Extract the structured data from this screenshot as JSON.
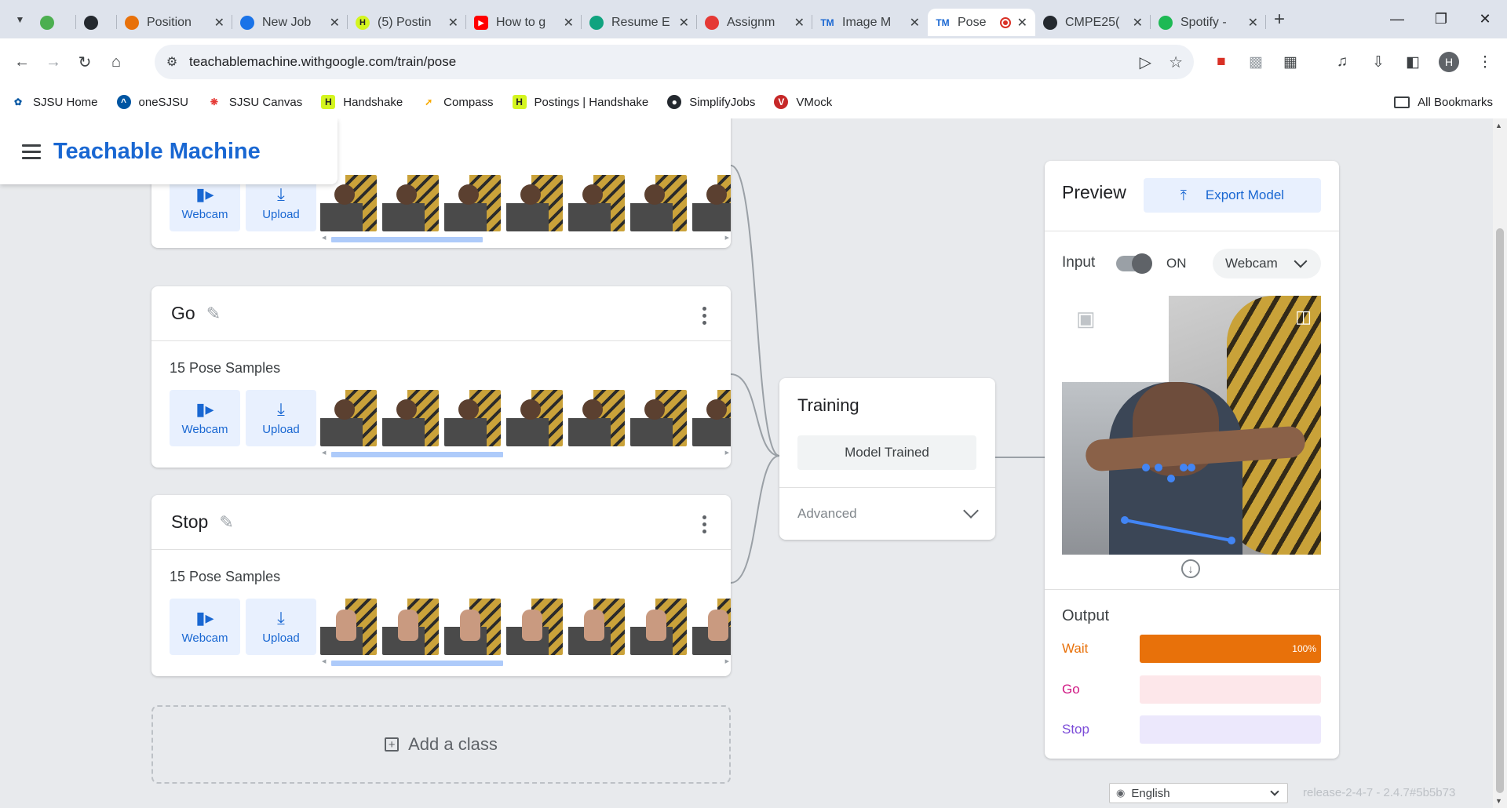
{
  "browser": {
    "tabs": [
      {
        "label": "",
        "favicon_color": "#4caf50",
        "favicon_text": ""
      },
      {
        "label": "",
        "favicon_color": "#24292f",
        "favicon_text": ""
      },
      {
        "label": "Position",
        "favicon_color": "#e8710a",
        "favicon_text": ""
      },
      {
        "label": "New Job",
        "favicon_color": "#1a73e8",
        "favicon_text": ""
      },
      {
        "label": "(5) Postin",
        "favicon_color": "#d4f51f",
        "favicon_text": "H"
      },
      {
        "label": "How to g",
        "favicon_color": "#ff0000",
        "favicon_text": "▶"
      },
      {
        "label": "Resume E",
        "favicon_color": "#10a37f",
        "favicon_text": ""
      },
      {
        "label": "Assignm",
        "favicon_color": "#e53935",
        "favicon_text": ""
      },
      {
        "label": "Image M",
        "favicon_color": "#1967d2",
        "favicon_text": "TM"
      },
      {
        "label": "Pose",
        "favicon_color": "#1967d2",
        "favicon_text": "TM",
        "active": true
      },
      {
        "label": "CMPE25(",
        "favicon_color": "#24292f",
        "favicon_text": ""
      },
      {
        "label": "Spotify -",
        "favicon_color": "#1db954",
        "favicon_text": ""
      }
    ],
    "url": "teachablemachine.withgoogle.com/train/pose",
    "profile_initial": "H",
    "bookmarks": [
      {
        "label": "SJSU Home",
        "icon": "sjsu-icon",
        "color": "#0055a2"
      },
      {
        "label": "oneSJSU",
        "icon": "onesjsu-icon",
        "color": "#0055a2"
      },
      {
        "label": "SJSU Canvas",
        "icon": "canvas-icon",
        "color": "#e53935"
      },
      {
        "label": "Handshake",
        "icon": "handshake-icon",
        "color": "#d4f51f"
      },
      {
        "label": "Compass",
        "icon": "compass-icon",
        "color": "#f9ab00"
      },
      {
        "label": "Postings | Handshake",
        "icon": "handshake-icon",
        "color": "#d4f51f"
      },
      {
        "label": "SimplifyJobs",
        "icon": "github-icon",
        "color": "#24292f"
      },
      {
        "label": "VMock",
        "icon": "vmock-icon",
        "color": "#c62828"
      }
    ],
    "all_bookmarks": "All Bookmarks"
  },
  "app": {
    "brand": "Teachable Machine",
    "accent_color": "#1967d2",
    "classes": [
      {
        "name": "",
        "samples_label": "",
        "webcam": "Webcam",
        "upload": "Upload",
        "thumb_kind": "arm"
      },
      {
        "name": "Go",
        "samples_label": "15 Pose Samples",
        "webcam": "Webcam",
        "upload": "Upload",
        "thumb_kind": "arm"
      },
      {
        "name": "Stop",
        "samples_label": "15 Pose Samples",
        "webcam": "Webcam",
        "upload": "Upload",
        "thumb_kind": "hand"
      }
    ],
    "add_class": "Add a class",
    "training": {
      "title": "Training",
      "button": "Model Trained",
      "advanced": "Advanced"
    },
    "preview": {
      "title": "Preview",
      "export": "Export Model",
      "input_label": "Input",
      "toggle_state": "ON",
      "source": "Webcam",
      "output_label": "Output",
      "outputs": [
        {
          "name": "Wait",
          "value": 1.0,
          "pct_text": "100%",
          "color": "#e8710a",
          "track": "#fde0c8"
        },
        {
          "name": "Go",
          "value": 0.0,
          "pct_text": "",
          "color": "#d01884",
          "track": "#fde7ea"
        },
        {
          "name": "Stop",
          "value": 0.0,
          "pct_text": "",
          "color": "#7b4bd8",
          "track": "#ece8fc"
        }
      ]
    },
    "footer": {
      "language": "English",
      "release": "release-2-4-7 - 2.4.7#5b5b73"
    }
  }
}
